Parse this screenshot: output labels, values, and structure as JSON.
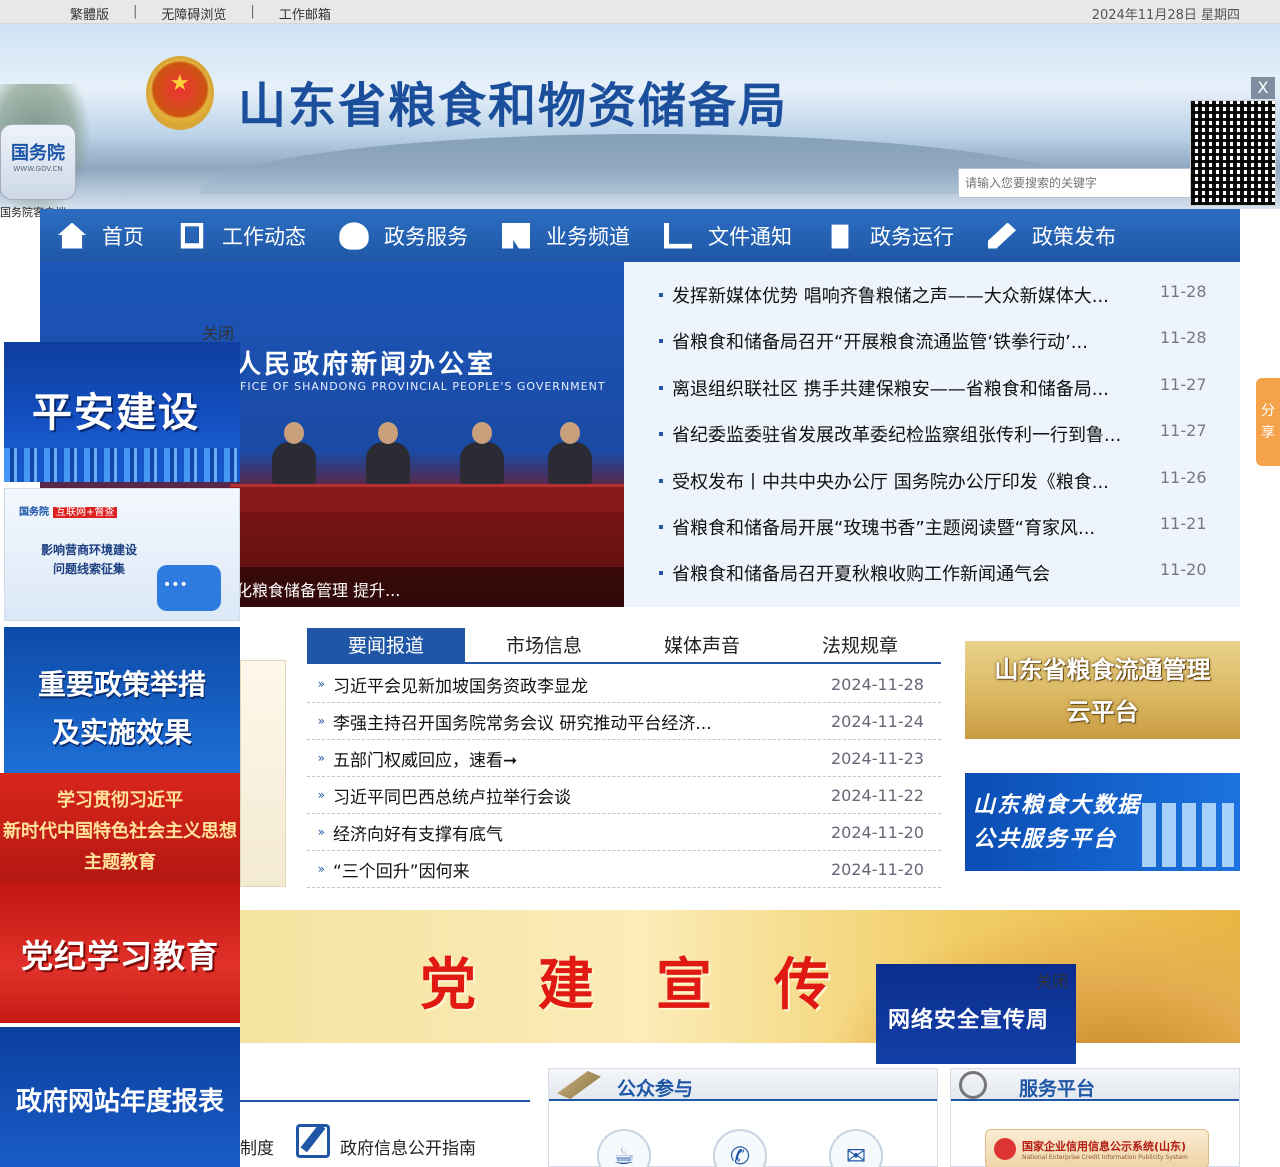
{
  "topbar": {
    "links": [
      "繁體版",
      "无障碍浏览",
      "工作邮箱"
    ],
    "separator": "|",
    "date": "2024年11月28日 星期四"
  },
  "header": {
    "title": "山东省粮食和物资储备局",
    "search_placeholder": "请输入您要搜索的关键字",
    "gov_app_title": "国务院",
    "gov_app_sub": "WWW.GOV.CN",
    "gov_app_caption": "国务院客户端",
    "qr_close": "X"
  },
  "nav": {
    "items": [
      {
        "label": "首页",
        "icon": "home-icon"
      },
      {
        "label": "工作动态",
        "icon": "document-icon"
      },
      {
        "label": "政务服务",
        "icon": "heart-icon"
      },
      {
        "label": "业务频道",
        "icon": "book-icon"
      },
      {
        "label": "文件通知",
        "icon": "chart-icon"
      },
      {
        "label": "政务运行",
        "icon": "clipboard-icon"
      },
      {
        "label": "政策发布",
        "icon": "pen-icon"
      }
    ]
  },
  "slide": {
    "banner_text": "人民政府新闻办公室",
    "banner_sub": "FICE OF SHANDONG PROVINCIAL PEOPLE'S GOVERNMENT",
    "caption": "化粮食储备管理 提升..."
  },
  "headline_news": [
    {
      "title": "发挥新媒体优势 唱响齐鲁粮储之声——大众新媒体大...",
      "date": "11-28"
    },
    {
      "title": "省粮食和储备局召开“开展粮食流通监管‘铁拳行动’...",
      "date": "11-28"
    },
    {
      "title": "离退组织联社区 携手共建保粮安——省粮食和储备局...",
      "date": "11-27"
    },
    {
      "title": "省纪委监委驻省发展改革委纪检监察组张传利一行到鲁...",
      "date": "11-27"
    },
    {
      "title": "受权发布丨中共中央办公厅 国务院办公厅印发《粮食...",
      "date": "11-26"
    },
    {
      "title": "省粮食和储备局开展“玫瑰书香”主题阅读暨“育家风...",
      "date": "11-21"
    },
    {
      "title": "省粮食和储备局召开夏秋粮收购工作新闻通气会",
      "date": "11-20"
    }
  ],
  "float_ads": {
    "close_label": "关闭",
    "ad1": "平安建设",
    "ad2_tag": "国务院",
    "ad2_tag_badge": "互联网+督查",
    "ad2_line1": "影响营商环境建设",
    "ad2_line2": "问题线索征集",
    "ad3_line1": "重要政策举措",
    "ad3_line2": "及实施效果",
    "ad4_line1": "学习贯彻习近平",
    "ad4_line2": "新时代中国特色社会主义思想",
    "ad4_line3": "主题教育",
    "ad5": "党纪学习教育",
    "ad6": "政府网站年度报表",
    "security_close": "关闭",
    "security_ad": "网络安全宣传周"
  },
  "tabs": {
    "items": [
      "要闻报道",
      "市场信息",
      "媒体声音",
      "法规规章"
    ],
    "active": 0,
    "marker": "»",
    "rows": [
      {
        "title": "习近平会见新加坡国务资政李显龙",
        "date": "2024-11-28"
      },
      {
        "title": "李强主持召开国务院常务会议 研究推动平台经济...",
        "date": "2024-11-24"
      },
      {
        "title": "五部门权威回应，速看➞",
        "date": "2024-11-23"
      },
      {
        "title": "习近平同巴西总统卢拉举行会谈",
        "date": "2024-11-22"
      },
      {
        "title": "经济向好有支撑有底气",
        "date": "2024-11-20"
      },
      {
        "title": "“三个回升”因何来",
        "date": "2024-11-20"
      }
    ]
  },
  "right_banners": {
    "b1_line1": "山东省粮食流通管理",
    "b1_line2": "云平台",
    "b2_line1": "山东粮食大数据",
    "b2_line2": "公共服务平台"
  },
  "party_banner": {
    "chars": [
      "党",
      "建",
      "宣",
      "传"
    ]
  },
  "bottom": {
    "left_a": "制度",
    "left_b": "政府信息公开指南",
    "public_title": "公众参与",
    "service_title": "服务平台",
    "credit_title": "国家企业信用信息公示系统(山东)",
    "credit_sub": "National Enterprise Credit Information Publicity System"
  },
  "share": {
    "line1": "分",
    "line2": "享"
  }
}
